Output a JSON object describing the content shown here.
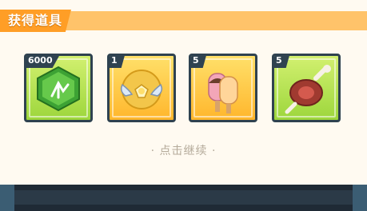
{
  "header": {
    "title": "获得道具"
  },
  "items": [
    {
      "name": "green-crystal",
      "count": "6000"
    },
    {
      "name": "winged-gold-emblem",
      "count": "1"
    },
    {
      "name": "ice-pop",
      "count": "5"
    },
    {
      "name": "roast-meat",
      "count": "5"
    }
  ],
  "hint": "· 点击继续 ·",
  "colors": {
    "accent": "#ff9e26",
    "panel": "#fffaf1",
    "frame": "#2f4250"
  }
}
